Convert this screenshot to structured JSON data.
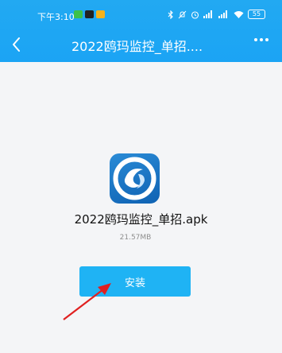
{
  "status_bar": {
    "time": "下午3:10",
    "battery": "55",
    "icons": [
      "wechat-icon",
      "tiktok-icon",
      "notes-icon",
      "bluetooth-icon",
      "mute-icon",
      "alarm-icon",
      "signal-icon",
      "signal-icon",
      "wifi-icon",
      "battery-icon"
    ]
  },
  "nav": {
    "title": "2022鸥玛监控_单招....",
    "back_icon": "chevron-left-icon",
    "more_icon": "more-icon"
  },
  "file": {
    "name": "2022鸥玛监控_单招.apk",
    "size": "21.57MB"
  },
  "install_button": {
    "label": "安装"
  },
  "colors": {
    "header": "#1ba4f4",
    "button": "#1fb3f4",
    "annotation_arrow": "#e02020"
  }
}
